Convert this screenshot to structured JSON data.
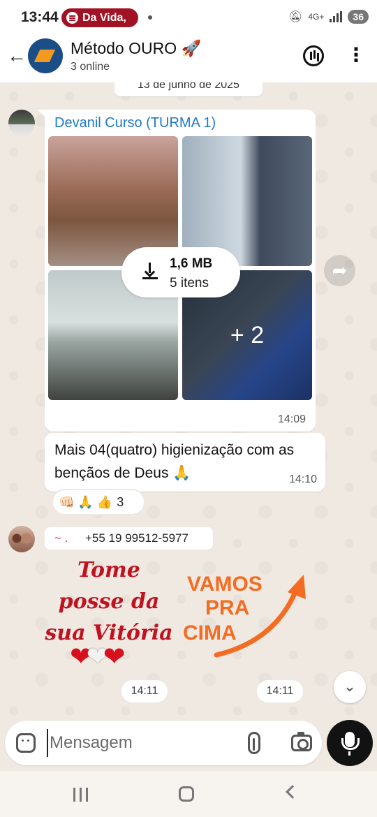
{
  "status_bar": {
    "time": "13:44",
    "spotify_label": "Da Vida,",
    "network": "4G+",
    "battery": "36"
  },
  "header": {
    "title": "Método OURO 🚀",
    "subtitle": "3 online"
  },
  "chat": {
    "date_chip": "13 de junho de 2025",
    "album_message": {
      "sender": "Devanil Curso (TURMA 1)",
      "download_size": "1,6 MB",
      "download_items": "5 itens",
      "more_count": "+ 2",
      "time": "14:09"
    },
    "text_message": {
      "text": "Mais 04(quatro) higienização com as bençãos de Deus 🙏",
      "time": "14:10"
    },
    "reactions": {
      "emojis": "👊🏻 🙏 👍",
      "count": "3"
    },
    "sticker_message": {
      "sender_name": "~ .",
      "sender_phone": "+55 19 99512-5977",
      "sticker_1_text": "Tome posse da sua Vitória",
      "sticker_2_line_1": "VAMOS",
      "sticker_2_line_2": "PRA",
      "sticker_2_line_3": "CIMA",
      "time_1": "14:11",
      "time_2": "14:11"
    }
  },
  "composer": {
    "placeholder": "Mensagem"
  },
  "icons": {
    "back": "arrow-left-icon",
    "call": "voice-chat-icon",
    "menu": "more-vertical-icon",
    "forward": "forward-icon",
    "download": "download-icon",
    "scroll_down": "double-chevron-down-icon",
    "sticker": "sticker-icon",
    "attach": "paperclip-icon",
    "camera": "camera-icon",
    "mic": "microphone-icon"
  },
  "colors": {
    "sender_name": "#1f7ac9",
    "chat_background": "#efe9e2",
    "spotify_pill": "#a11224",
    "sticker_red": "#c1121f",
    "sticker_orange": "#f36c21"
  }
}
